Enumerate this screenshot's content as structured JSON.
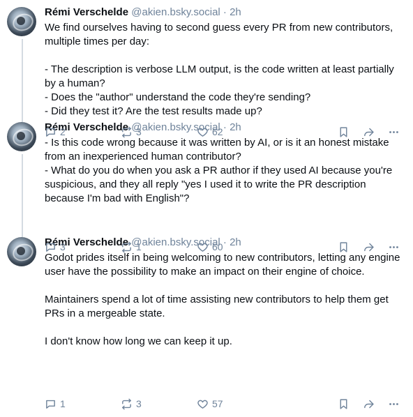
{
  "posts": [
    {
      "display_name": "Rémi Verschelde",
      "handle": "@akien.bsky.social",
      "separator": "·",
      "time": "2h",
      "text": "We find ourselves having to second guess every PR from new contributors, multiple times per day:\n\n- The description is verbose LLM output, is the code written at least partially by a human?\n- Does the \"author\" understand the code they're sending?\n- Did they test it? Are the test results made up?",
      "replies": "2",
      "reposts": "3",
      "likes": "62"
    },
    {
      "display_name": "Rémi Verschelde",
      "handle": "@akien.bsky.social",
      "separator": "·",
      "time": "2h",
      "text": "- Is this code wrong because it was written by AI, or is it an honest mistake from an inexperienced human contributor?\n- What do you do when you ask a PR author if they used AI because you're suspicious, and they all reply \"yes I used it to write the PR description because I'm bad with English\"?",
      "replies": "3",
      "reposts": "1",
      "likes": "60"
    },
    {
      "display_name": "Rémi Verschelde",
      "handle": "@akien.bsky.social",
      "separator": "·",
      "time": "2h",
      "text": "Godot prides itself in being welcoming to new contributors, letting any engine user have the possibility to make an impact on their engine of choice.\n\nMaintainers spend a lot of time assisting new contributors to help them get PRs in a mergeable state.\n\nI don't know how long we can keep it up.",
      "replies": "1",
      "reposts": "3",
      "likes": "57"
    }
  ],
  "icons": {
    "reply": "reply-bubble-icon",
    "repost": "repost-arrows-icon",
    "like": "heart-icon",
    "bookmark": "bookmark-icon",
    "share": "share-arrow-icon",
    "more": "more-dots-icon"
  },
  "colors": {
    "text": "#0b0f14",
    "muted": "#6f839a",
    "thread_line": "#d4dbe2"
  }
}
